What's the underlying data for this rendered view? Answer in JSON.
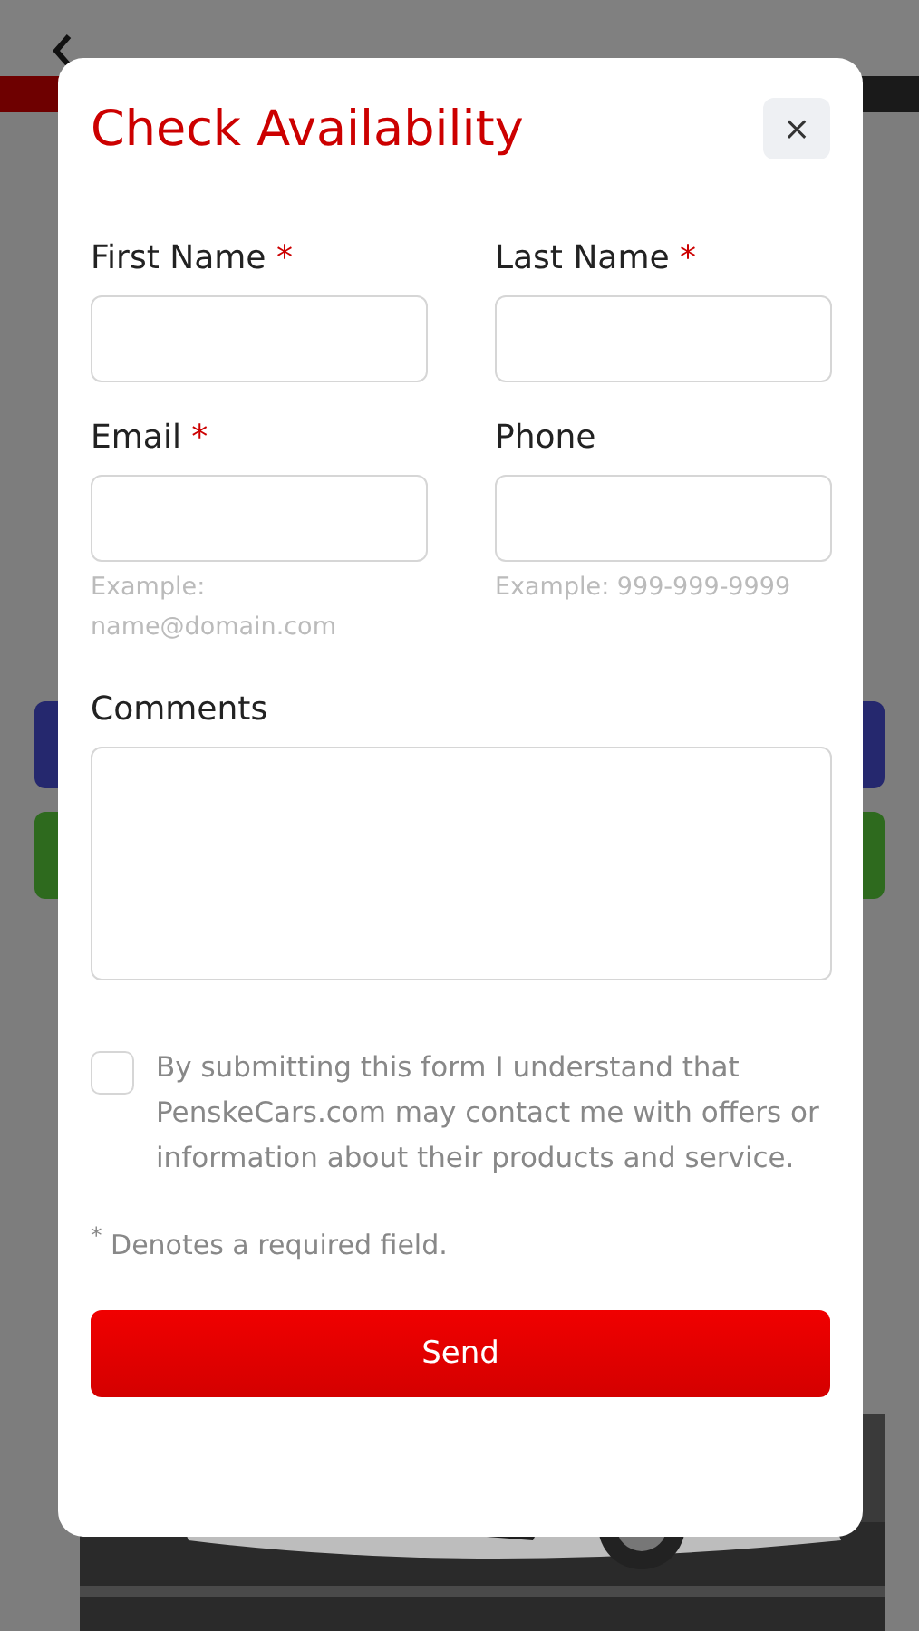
{
  "modal": {
    "title": "Check Availability",
    "close_label": "×",
    "required_mark": "*",
    "fields": [
      {
        "label": "First Name",
        "required": true,
        "kind": "input"
      },
      {
        "label": "Last Name",
        "required": true,
        "kind": "input"
      },
      {
        "label": "Email",
        "required": true,
        "kind": "input",
        "help": "Example: name@domain.com"
      },
      {
        "label": "Phone",
        "required": false,
        "kind": "input",
        "help": "Example: 999-999-9999"
      },
      {
        "label": "Comments",
        "required": false,
        "kind": "textarea"
      }
    ],
    "consent": {
      "checked": false,
      "text": "By submitting this form I understand that PenskeCars.com may contact me with offers or information about their products and service."
    },
    "note": "$^{*}$ Denotes a required field.",
    "submit": "Send"
  }
}
